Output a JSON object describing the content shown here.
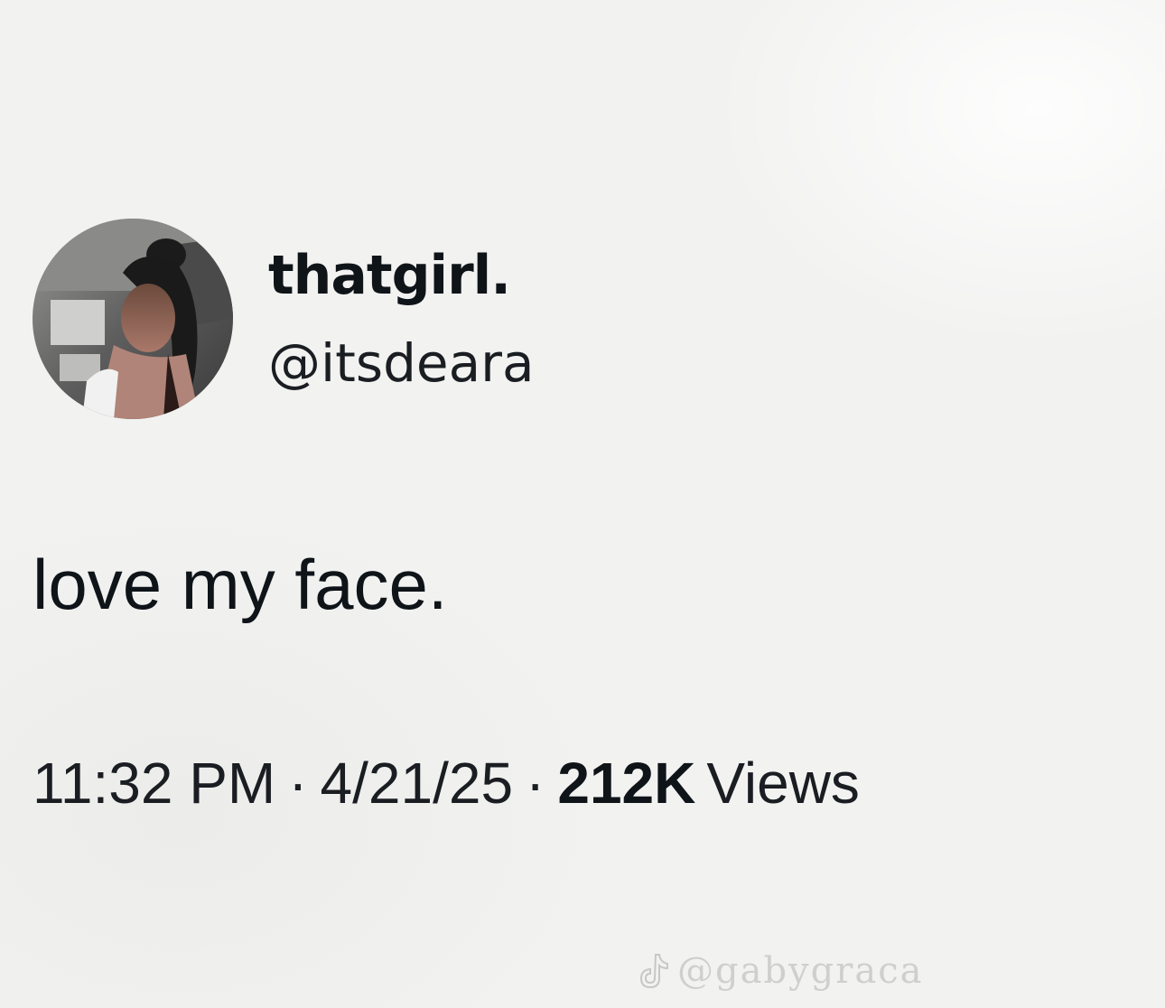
{
  "author": {
    "display_name": "thatgirl.",
    "handle": "@itsdeara",
    "avatar_icon": "profile-photo"
  },
  "tweet": {
    "text": "love my face."
  },
  "meta": {
    "time": "11:32 PM",
    "separator": "·",
    "date": "4/21/25",
    "views_count": "212K",
    "views_label": "Views"
  },
  "watermark": {
    "icon": "tiktok-icon",
    "text": "@gabygraca"
  },
  "colors": {
    "background": "#f2f2f1",
    "text_primary": "#0f1419"
  }
}
